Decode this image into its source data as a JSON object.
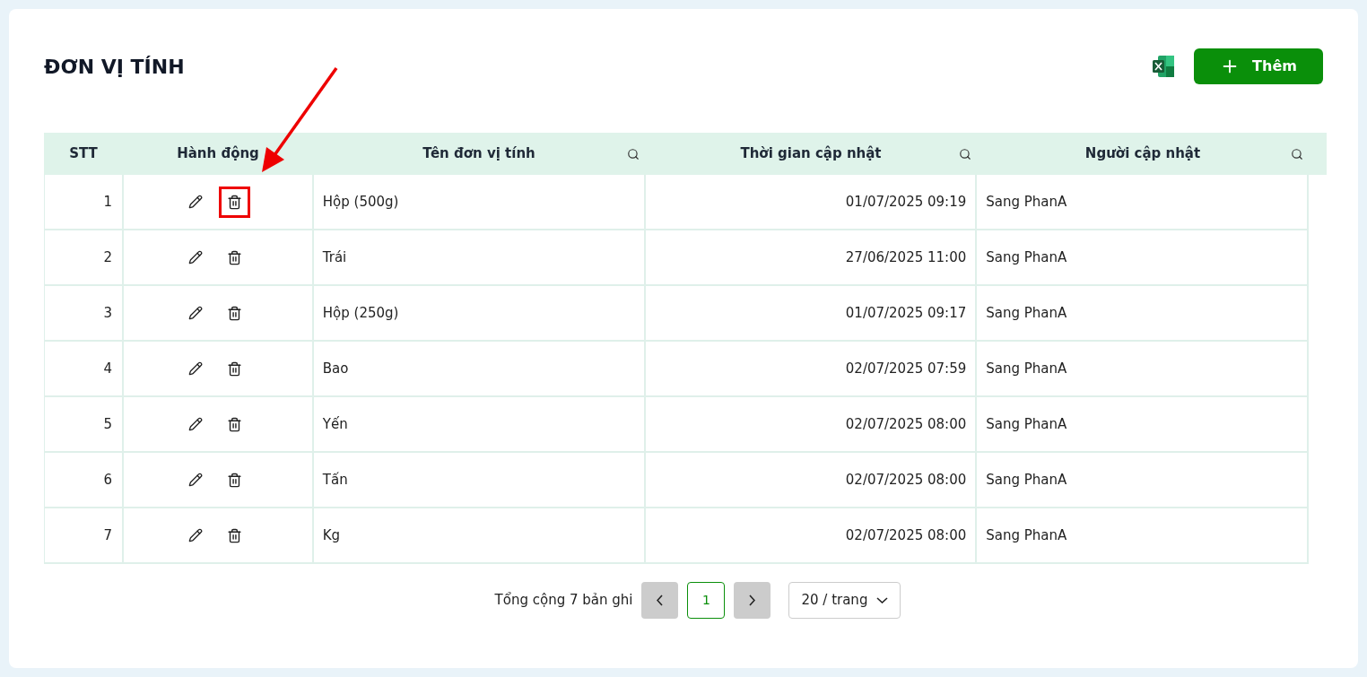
{
  "title": "ĐƠN VỊ TÍNH",
  "add_button": {
    "label": "Thêm"
  },
  "table": {
    "columns": [
      {
        "label": "STT",
        "searchable": false
      },
      {
        "label": "Hành động",
        "searchable": false
      },
      {
        "label": "Tên đơn vị tính",
        "searchable": true
      },
      {
        "label": "Thời gian cập nhật",
        "searchable": true
      },
      {
        "label": "Người cập nhật",
        "searchable": true
      }
    ],
    "rows": [
      {
        "stt": "1",
        "name": "Hộp (500g)",
        "updated_at": "01/07/2025 09:19",
        "updated_by": "Sang PhanA",
        "delete_highlighted": true
      },
      {
        "stt": "2",
        "name": "Trái",
        "updated_at": "27/06/2025 11:00",
        "updated_by": "Sang PhanA",
        "delete_highlighted": false
      },
      {
        "stt": "3",
        "name": "Hộp (250g)",
        "updated_at": "01/07/2025 09:17",
        "updated_by": "Sang PhanA",
        "delete_highlighted": false
      },
      {
        "stt": "4",
        "name": "Bao",
        "updated_at": "02/07/2025 07:59",
        "updated_by": "Sang PhanA",
        "delete_highlighted": false
      },
      {
        "stt": "5",
        "name": "Yến",
        "updated_at": "02/07/2025 08:00",
        "updated_by": "Sang PhanA",
        "delete_highlighted": false
      },
      {
        "stt": "6",
        "name": "Tấn",
        "updated_at": "02/07/2025 08:00",
        "updated_by": "Sang PhanA",
        "delete_highlighted": false
      },
      {
        "stt": "7",
        "name": "Kg",
        "updated_at": "02/07/2025 08:00",
        "updated_by": "Sang PhanA",
        "delete_highlighted": false
      }
    ]
  },
  "pagination": {
    "total": "Tổng cộng 7 bản ghi",
    "pages": [
      {
        "label": "1",
        "selected": true
      }
    ],
    "page_size": "20 / trang"
  }
}
